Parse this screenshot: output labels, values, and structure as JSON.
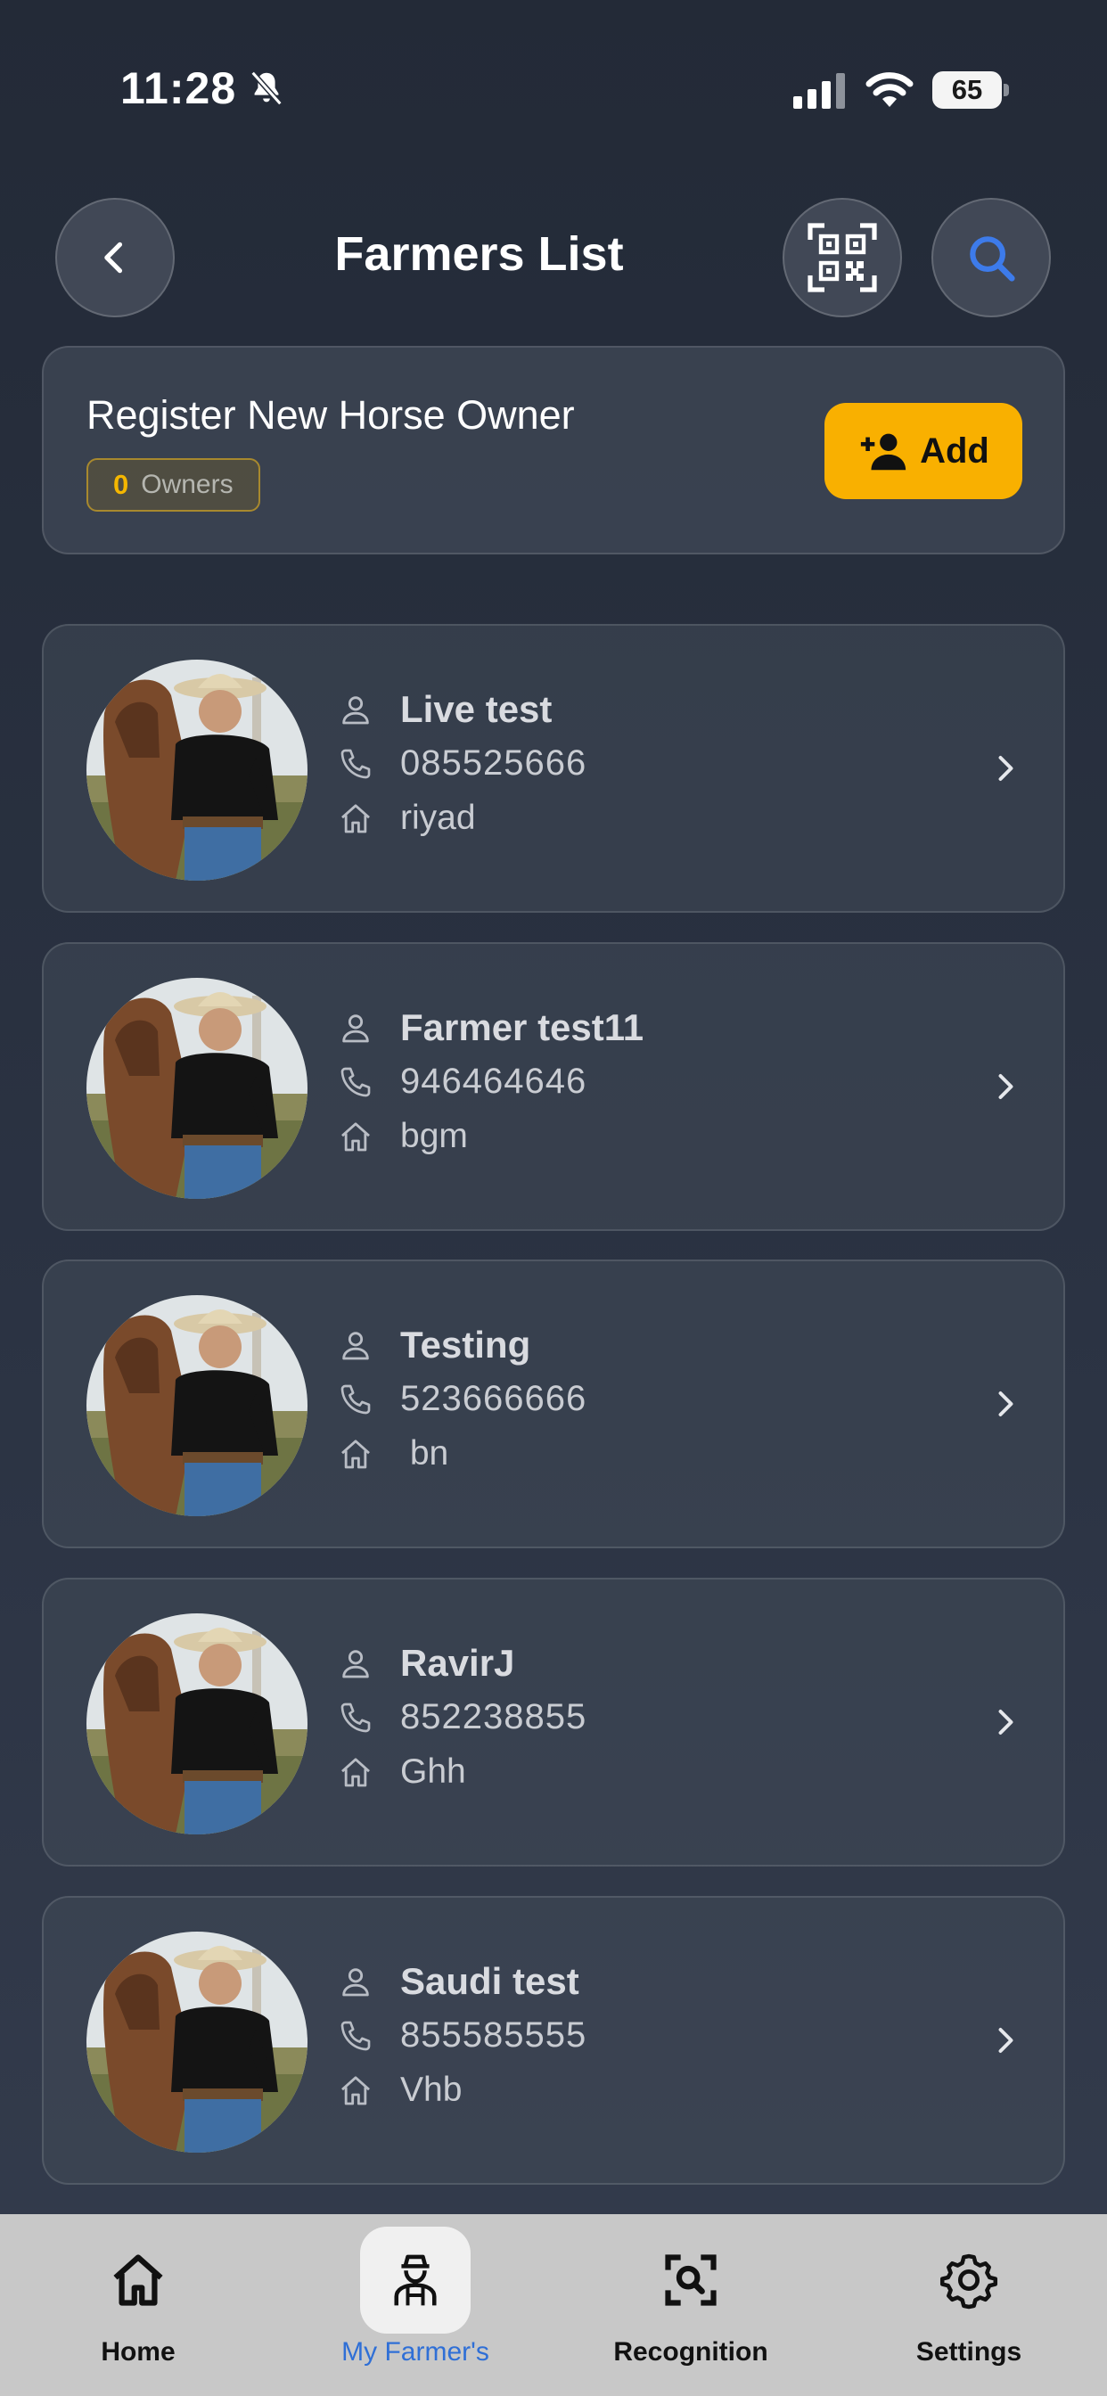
{
  "status_bar": {
    "time": "11:28",
    "battery_level": "65"
  },
  "header": {
    "title": "Farmers List",
    "back_icon": "chevron-left-icon",
    "qr_icon": "qr-code-icon",
    "search_icon": "search-icon",
    "search_color": "#3d7bea"
  },
  "register": {
    "title": "Register New Horse Owner",
    "owners_count": "0",
    "owners_label": "Owners",
    "add_label": "Add",
    "add_color": "#f9b000"
  },
  "farmers": [
    {
      "name": "Live test",
      "phone": "085525666",
      "city": "riyad"
    },
    {
      "name": "Farmer test11",
      "phone": "946464646",
      "city": "bgm"
    },
    {
      "name": "Testing",
      "phone": "523666666",
      "city": " bn"
    },
    {
      "name": "RavirJ",
      "phone": "852238855",
      "city": "Ghh"
    },
    {
      "name": "Saudi test",
      "phone": "855585555",
      "city": "Vhb"
    }
  ],
  "bottom_nav": {
    "active_color": "#2f6fd6",
    "items": [
      {
        "label": "Home",
        "icon": "home-icon"
      },
      {
        "label": "My Farmer's",
        "icon": "farmer-icon",
        "active": true
      },
      {
        "label": "Recognition",
        "icon": "scan-search-icon"
      },
      {
        "label": "Settings",
        "icon": "gear-icon"
      }
    ]
  }
}
